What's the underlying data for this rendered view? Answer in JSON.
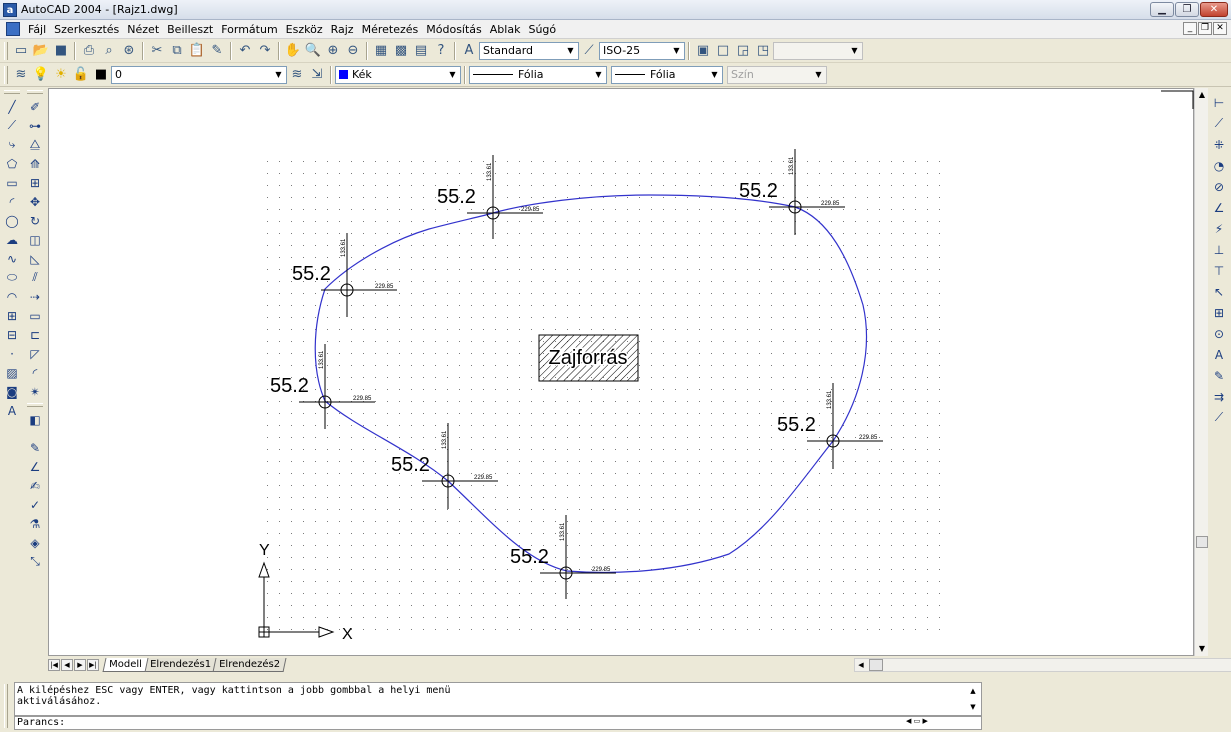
{
  "window": {
    "title": "AutoCAD 2004 - [Rajz1.dwg]",
    "app_icon_letter": "a"
  },
  "menu": [
    "Fájl",
    "Szerkesztés",
    "Nézet",
    "Beilleszt",
    "Formátum",
    "Eszköz",
    "Rajz",
    "Méretezés",
    "Módosítás",
    "Ablak",
    "Súgó"
  ],
  "toolbar_standard": {
    "text_style": "Standard",
    "dim_style": "ISO-25"
  },
  "toolbar_properties": {
    "layer": "0",
    "color": "Kék",
    "color_hex": "#0000ff",
    "linetype": "Fólia",
    "lineweight": "Fólia",
    "plot_style": "Szín"
  },
  "drawing": {
    "source_label": "Zajforrás",
    "points": [
      {
        "level": "55.2",
        "coord_y": "133.61",
        "coord_x": "229.85"
      },
      {
        "level": "55.2",
        "coord_y": "133.61",
        "coord_x": "229.85"
      },
      {
        "level": "55.2",
        "coord_y": "133.61",
        "coord_x": "229.85"
      },
      {
        "level": "55.2",
        "coord_y": "133.61",
        "coord_x": "229.85"
      },
      {
        "level": "55.2",
        "coord_y": "133.61",
        "coord_x": "229.85"
      },
      {
        "level": "55.2",
        "coord_y": "133.61",
        "coord_x": "229.85"
      },
      {
        "level": "55.2",
        "coord_y": "133.61",
        "coord_x": "229.85"
      }
    ],
    "ucs": {
      "x_label": "X",
      "y_label": "Y"
    },
    "curve_color": "#3333cc"
  },
  "tabs": [
    "Modell",
    "Elrendezés1",
    "Elrendezés2"
  ],
  "active_tab": "Modell",
  "command": {
    "history_line1": "A kilépéshez ESC vagy ENTER, vagy kattintson a jobb gombbal a helyi menü",
    "history_line2": "aktiválásához.",
    "prompt": "Parancs:"
  }
}
